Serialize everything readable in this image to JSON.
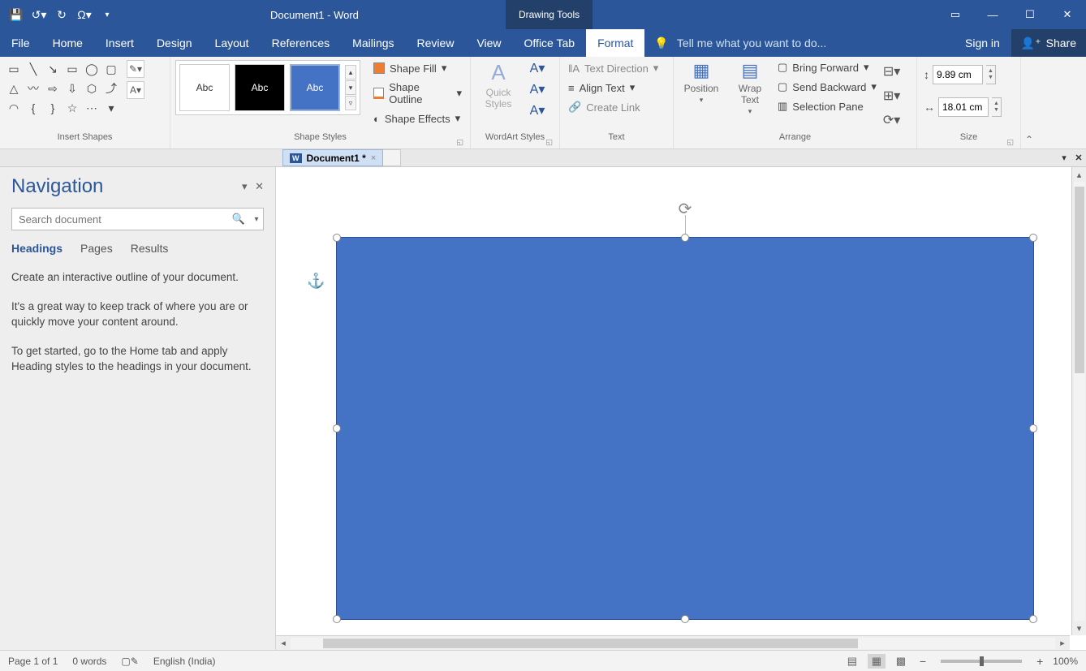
{
  "title": "Document1 - Word",
  "contextual_tab": "Drawing Tools",
  "tabs": {
    "file": "File",
    "home": "Home",
    "insert": "Insert",
    "design": "Design",
    "layout": "Layout",
    "references": "References",
    "mailings": "Mailings",
    "review": "Review",
    "view": "View",
    "officetab": "Office Tab",
    "format": "Format"
  },
  "tellme_placeholder": "Tell me what you want to do...",
  "signin": "Sign in",
  "share": "Share",
  "ribbon": {
    "insert_shapes": "Insert Shapes",
    "shape_styles": "Shape Styles",
    "style_label": "Abc",
    "shape_fill": "Shape Fill",
    "shape_outline": "Shape Outline",
    "shape_effects": "Shape Effects",
    "wordart_styles": "WordArt Styles",
    "quick_styles": "Quick\nStyles",
    "text": "Text",
    "text_direction": "Text Direction",
    "align_text": "Align Text",
    "create_link": "Create Link",
    "arrange": "Arrange",
    "position": "Position",
    "wrap_text": "Wrap\nText",
    "bring_forward": "Bring Forward",
    "send_backward": "Send Backward",
    "selection_pane": "Selection Pane",
    "size": "Size",
    "height": "9.89 cm",
    "width": "18.01 cm"
  },
  "doctab": "Document1 *",
  "nav": {
    "title": "Navigation",
    "search_placeholder": "Search document",
    "tab_headings": "Headings",
    "tab_pages": "Pages",
    "tab_results": "Results",
    "p1": "Create an interactive outline of your document.",
    "p2": "It's a great way to keep track of where you are or quickly move your content around.",
    "p3": "To get started, go to the Home tab and apply Heading styles to the headings in your document."
  },
  "status": {
    "page": "Page 1 of 1",
    "words": "0 words",
    "lang": "English (India)",
    "zoom": "100%"
  }
}
